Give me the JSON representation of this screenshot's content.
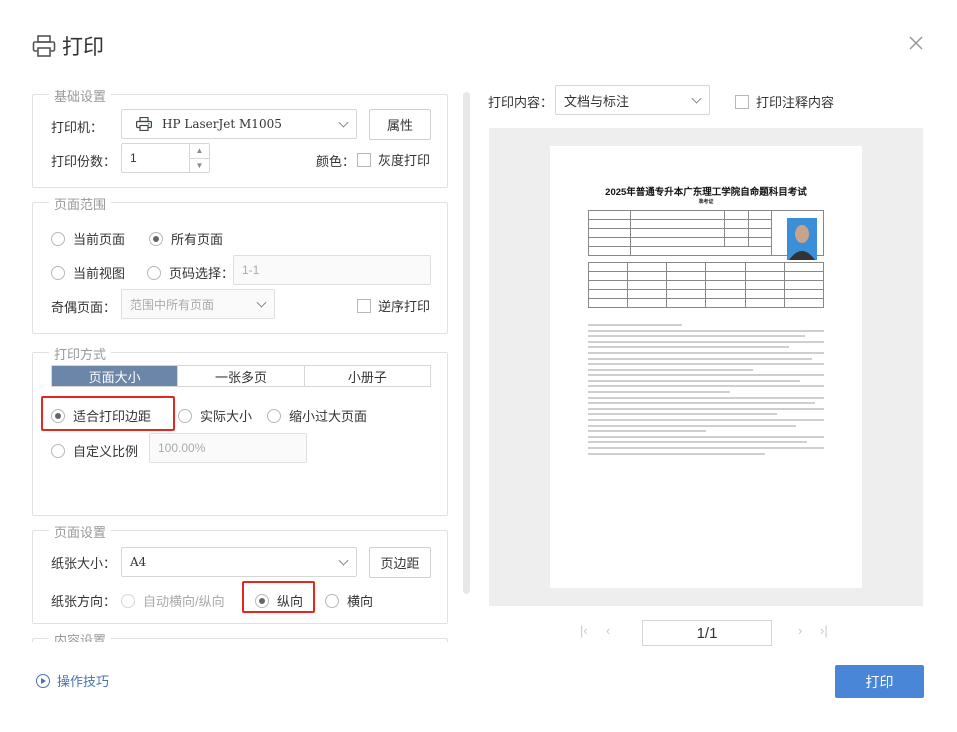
{
  "dialog": {
    "title": "打印",
    "close_icon": "close-icon"
  },
  "basic": {
    "group_title": "基础设置",
    "printer_label": "打印机：",
    "printer_value": "HP LaserJet M1005",
    "properties_button": "属性",
    "copies_label": "打印份数：",
    "copies_value": "1",
    "color_label": "颜色：",
    "grayscale_label": "灰度打印"
  },
  "range": {
    "group_title": "页面范围",
    "current_page": "当前页面",
    "all_pages": "所有页面",
    "current_view": "当前视图",
    "page_select": "页码选择：",
    "page_select_placeholder": "1-1",
    "odd_even_label": "奇偶页面：",
    "odd_even_value": "范围中所有页面",
    "reverse_label": "逆序打印"
  },
  "mode": {
    "group_title": "打印方式",
    "tabs": [
      "页面大小",
      "一张多页",
      "小册子"
    ],
    "fit_margins": "适合打印边距",
    "actual_size": "实际大小",
    "shrink_large": "缩小过大页面",
    "custom_scale": "自定义比例",
    "custom_scale_value": "100.00%"
  },
  "page_setup": {
    "group_title": "页面设置",
    "paper_size_label": "纸张大小：",
    "paper_size_value": "A4",
    "margins_button": "页边距",
    "orientation_label": "纸张方向：",
    "auto_orientation": "自动横向/纵向",
    "portrait": "纵向",
    "landscape": "横向"
  },
  "content": {
    "group_title": "内容设置"
  },
  "print_content": {
    "label": "打印内容：",
    "value": "文档与标注",
    "annotation_label": "打印注释内容"
  },
  "preview": {
    "page_indicator": "1/1",
    "doc_title": "2025年普通专升本广东理工学院自命题科目考试",
    "doc_subtitle": "准考证"
  },
  "footer": {
    "tips_label": "操作技巧",
    "print_button": "打印"
  },
  "colors": {
    "accent": "#4a86d8",
    "highlight": "#e0281e",
    "tab_active": "#6b86a8"
  }
}
